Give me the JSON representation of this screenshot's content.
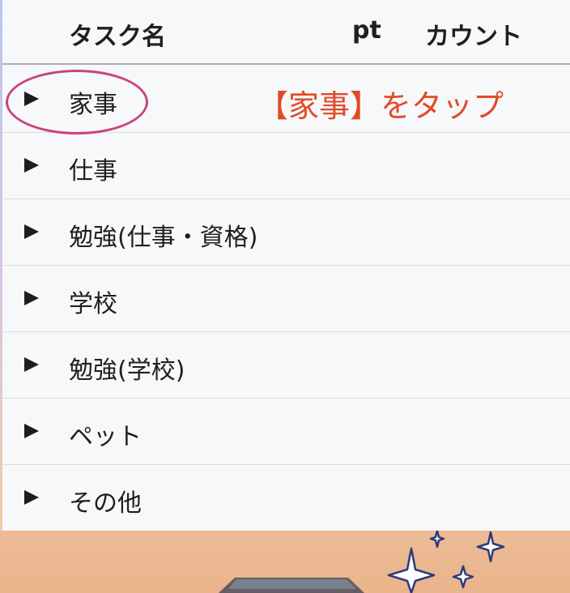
{
  "table": {
    "header": {
      "name": "タスク名",
      "pt": "pt",
      "count": "カウント"
    },
    "rows": [
      {
        "label": "家事"
      },
      {
        "label": "仕事"
      },
      {
        "label": "勉強(仕事・資格)"
      },
      {
        "label": "学校"
      },
      {
        "label": "勉強(学校)"
      },
      {
        "label": "ペット"
      },
      {
        "label": "その他"
      }
    ]
  },
  "annotation": {
    "text": "【家事】をタップ",
    "color": "#e04b2a",
    "circle_color": "#c9457a"
  },
  "icons": {
    "expand": "triangle-right-icon"
  }
}
